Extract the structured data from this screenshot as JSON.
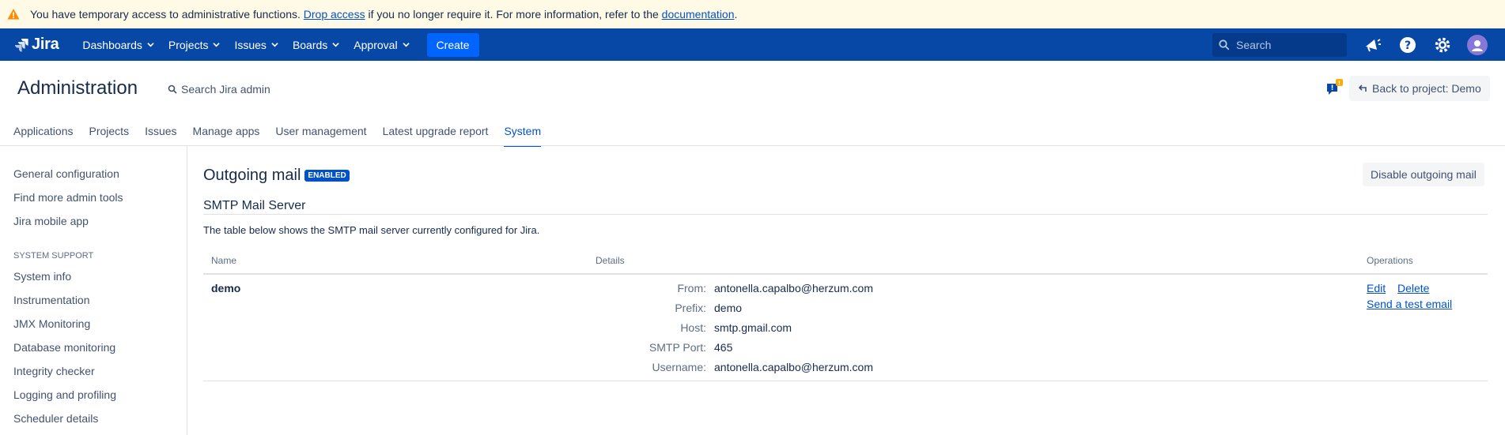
{
  "banner": {
    "text_before": "You have temporary access to administrative functions. ",
    "drop_access_link": "Drop access",
    "text_middle": " if you no longer require it. For more information, refer to the ",
    "documentation_link": "documentation",
    "text_after": "."
  },
  "topnav": {
    "logo": "Jira",
    "items": [
      {
        "label": "Dashboards"
      },
      {
        "label": "Projects"
      },
      {
        "label": "Issues"
      },
      {
        "label": "Boards"
      },
      {
        "label": "Approval"
      }
    ],
    "create_label": "Create",
    "search_placeholder": "Search",
    "icons": [
      "notifications-icon",
      "help-icon",
      "settings-icon",
      "avatar"
    ]
  },
  "admin": {
    "title": "Administration",
    "search_label": "Search Jira admin",
    "feedback_count": "!",
    "back_button": "Back to project: Demo"
  },
  "tabs": [
    {
      "label": "Applications"
    },
    {
      "label": "Projects"
    },
    {
      "label": "Issues"
    },
    {
      "label": "Manage apps"
    },
    {
      "label": "User management"
    },
    {
      "label": "Latest upgrade report"
    },
    {
      "label": "System",
      "active": true
    }
  ],
  "sidebar": {
    "top_items": [
      "General configuration",
      "Find more admin tools",
      "Jira mobile app"
    ],
    "system_support_heading": "SYSTEM SUPPORT",
    "support_items": [
      "System info",
      "Instrumentation",
      "JMX Monitoring",
      "Database monitoring",
      "Integrity checker",
      "Logging and profiling",
      "Scheduler details"
    ]
  },
  "main": {
    "title": "Outgoing mail",
    "status_badge": "ENABLED",
    "disable_button": "Disable outgoing mail",
    "section_title": "SMTP Mail Server",
    "description": "The table below shows the SMTP mail server currently configured for Jira.",
    "columns": {
      "name": "Name",
      "details": "Details",
      "operations": "Operations"
    },
    "server": {
      "name": "demo",
      "details": [
        {
          "label": "From:",
          "value": "antonella.capalbo@herzum.com"
        },
        {
          "label": "Prefix:",
          "value": "demo"
        },
        {
          "label": "Host:",
          "value": "smtp.gmail.com"
        },
        {
          "label": "SMTP Port:",
          "value": "465"
        },
        {
          "label": "Username:",
          "value": "antonella.capalbo@herzum.com"
        }
      ],
      "operations": {
        "edit": "Edit",
        "delete": "Delete",
        "test": "Send a test email"
      }
    }
  },
  "colors": {
    "nav_bg": "#0747a6",
    "link": "#0052cc",
    "banner_bg": "#fffae6",
    "create_bg": "#0065ff"
  }
}
